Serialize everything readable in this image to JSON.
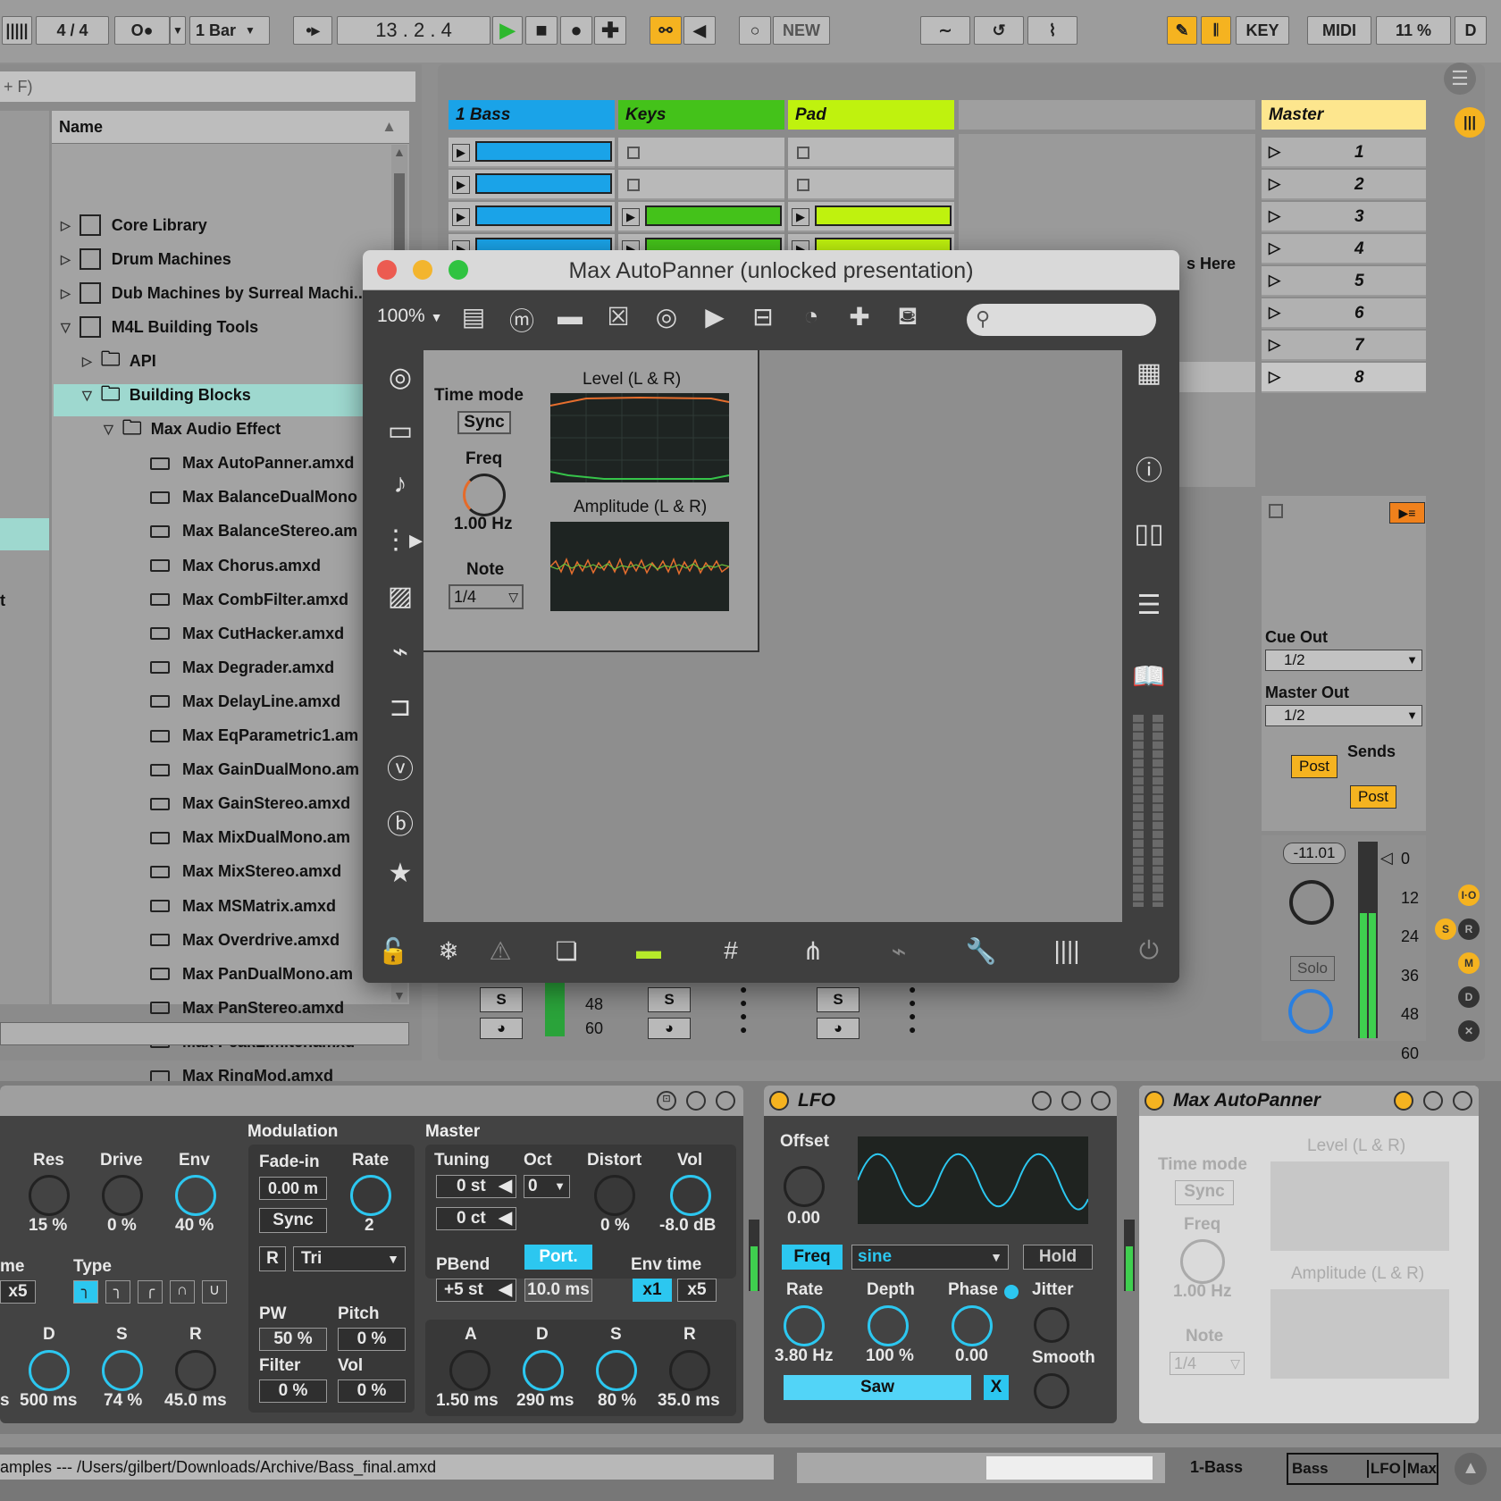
{
  "transport": {
    "signature": "4 / 4",
    "quantize": "1 Bar",
    "position": "13 .   2 .   4",
    "new_label": "NEW",
    "key_label": "KEY",
    "midi_label": "MIDI",
    "cpu_label": "11 %",
    "d_label": "D"
  },
  "browser": {
    "search_hint": "+ F)",
    "column_header": "Name",
    "items": [
      {
        "label": "Core Library",
        "type": "folder"
      },
      {
        "label": "Drum Machines",
        "type": "folder"
      },
      {
        "label": "Dub Machines by Surreal Machi..",
        "type": "folder"
      },
      {
        "label": "M4L Building Tools",
        "type": "folder"
      },
      {
        "label": "API",
        "type": "subfolder"
      },
      {
        "label": "Building Blocks",
        "type": "subfolder"
      },
      {
        "label": "Max Audio Effect",
        "type": "subfolder"
      },
      {
        "label": "Max AutoPanner.amxd",
        "type": "device"
      },
      {
        "label": "Max BalanceDualMono",
        "type": "device"
      },
      {
        "label": "Max BalanceStereo.am",
        "type": "device"
      },
      {
        "label": "Max Chorus.amxd",
        "type": "device"
      },
      {
        "label": "Max CombFilter.amxd",
        "type": "device"
      },
      {
        "label": "Max CutHacker.amxd",
        "type": "device"
      },
      {
        "label": "Max Degrader.amxd",
        "type": "device"
      },
      {
        "label": "Max DelayLine.amxd",
        "type": "device"
      },
      {
        "label": "Max EqParametric1.am",
        "type": "device"
      },
      {
        "label": "Max GainDualMono.am",
        "type": "device"
      },
      {
        "label": "Max GainStereo.amxd",
        "type": "device"
      },
      {
        "label": "Max MixDualMono.am",
        "type": "device"
      },
      {
        "label": "Max MixStereo.amxd",
        "type": "device"
      },
      {
        "label": "Max MSMatrix.amxd",
        "type": "device"
      },
      {
        "label": "Max Overdrive.amxd",
        "type": "device"
      },
      {
        "label": "Max PanDualMono.am",
        "type": "device"
      },
      {
        "label": "Max PanStereo.amxd",
        "type": "device"
      },
      {
        "label": "Max PeakLimiter.amxd",
        "type": "device"
      },
      {
        "label": "Max RingMod.amxd",
        "type": "device"
      }
    ],
    "left_edge_text": "t"
  },
  "session": {
    "tracks": [
      {
        "name": "1 Bass",
        "color": "#1aa3e8"
      },
      {
        "name": "Keys",
        "color": "#44c21a"
      },
      {
        "name": "Pad",
        "color": "#bff20e"
      }
    ],
    "master_name": "Master",
    "master_color": "#fde68e",
    "scenes": [
      "1",
      "2",
      "3",
      "4",
      "5",
      "6",
      "7",
      "8"
    ],
    "drop_hint": "s Here",
    "cue_out_label": "Cue Out",
    "cue_out_value": "1/2",
    "master_out_label": "Master Out",
    "master_out_value": "1/2",
    "sends_label": "Sends",
    "post1": "Post",
    "post2": "Post",
    "volume_readout": "-11.01",
    "solo_label": "Solo",
    "meter_scale": [
      "0",
      "12",
      "24",
      "36",
      "48",
      "60"
    ],
    "track_meter_scale": [
      "48",
      "60"
    ],
    "s_label": "S",
    "side_buttons": [
      "I·O",
      "S",
      "R",
      "M",
      "D",
      "✕"
    ]
  },
  "maxwindow": {
    "title": "Max AutoPanner (unlocked presentation)",
    "zoom": "100%",
    "time_mode_label": "Time mode",
    "sync_label": "Sync",
    "freq_label": "Freq",
    "freq_value": "1.00 Hz",
    "note_label": "Note",
    "note_value": "1/4",
    "level_label": "Level (L & R)",
    "amplitude_label": "Amplitude (L & R)"
  },
  "devices": {
    "synth": {
      "modulation_label": "Modulation",
      "master_label": "Master",
      "res_label": "Res",
      "res_value": "15 %",
      "drive_label": "Drive",
      "drive_value": "0 %",
      "env_label": "Env",
      "env_value": "40 %",
      "fadein_label": "Fade-in",
      "fadein_value": "0.00 m",
      "rate_label": "Rate",
      "rate_value": "2",
      "sync_label": "Sync",
      "r_label": "R",
      "wave_value": "Tri",
      "tuning_label": "Tuning",
      "tuning_st": "0 st",
      "tuning_ct": "0 ct",
      "oct_label": "Oct",
      "oct_value": "0",
      "distort_label": "Distort",
      "distort_value": "0 %",
      "vol_label": "Vol",
      "vol_value": "-8.0 dB",
      "type_label": "Type",
      "me_label": "me",
      "x5_label": "x5",
      "pbend_label": "PBend",
      "pbend_value": "+5 st",
      "port_label": "Port.",
      "port_value": "10.0 ms",
      "envtime_label": "Env time",
      "x1_label": "x1",
      "x5b_label": "x5",
      "pw_label": "PW",
      "pw_value": "50 %",
      "pitch_label": "Pitch",
      "pitch_value": "0 %",
      "filter_label": "Filter",
      "filter_value": "0 %",
      "vol2_label": "Vol",
      "vol2_value": "0 %",
      "d_label": "D",
      "d_value": "500 ms",
      "s_label": "S",
      "s_value": "74 %",
      "r_label2": "R",
      "r_value": "45.0 ms",
      "s_left": "s",
      "a_label": "A",
      "a_value": "1.50 ms",
      "d2_label": "D",
      "d2_value": "290 ms",
      "s2_label": "S",
      "s2_value": "80 %",
      "r2_label": "R",
      "r2_value": "35.0 ms"
    },
    "lfo": {
      "title": "LFO",
      "offset_label": "Offset",
      "offset_value": "0.00",
      "freq_label": "Freq",
      "wave_value": "sine",
      "hold_label": "Hold",
      "rate_label": "Rate",
      "rate_value": "3.80 Hz",
      "depth_label": "Depth",
      "depth_value": "100 %",
      "phase_label": "Phase",
      "phase_value": "0.00",
      "jitter_label": "Jitter",
      "smooth_label": "Smooth",
      "saw_label": "Saw",
      "x_label": "X"
    },
    "autopanner": {
      "title": "Max AutoPanner",
      "time_mode_label": "Time mode",
      "sync_label": "Sync",
      "freq_label": "Freq",
      "freq_value": "1.00 Hz",
      "note_label": "Note",
      "note_value": "1/4",
      "level_label": "Level (L & R)",
      "amplitude_label": "Amplitude (L & R)"
    }
  },
  "statusbar": {
    "path": "amples --- /Users/gilbert/Downloads/Archive/Bass_final.amxd",
    "track": "1-Bass",
    "chain": [
      "Bass",
      "LFO",
      "Max"
    ]
  },
  "colors": {
    "accent_cyan": "#2cc7f0",
    "accent_orange": "#f5b320",
    "selected_row": "#9ed8cf"
  }
}
